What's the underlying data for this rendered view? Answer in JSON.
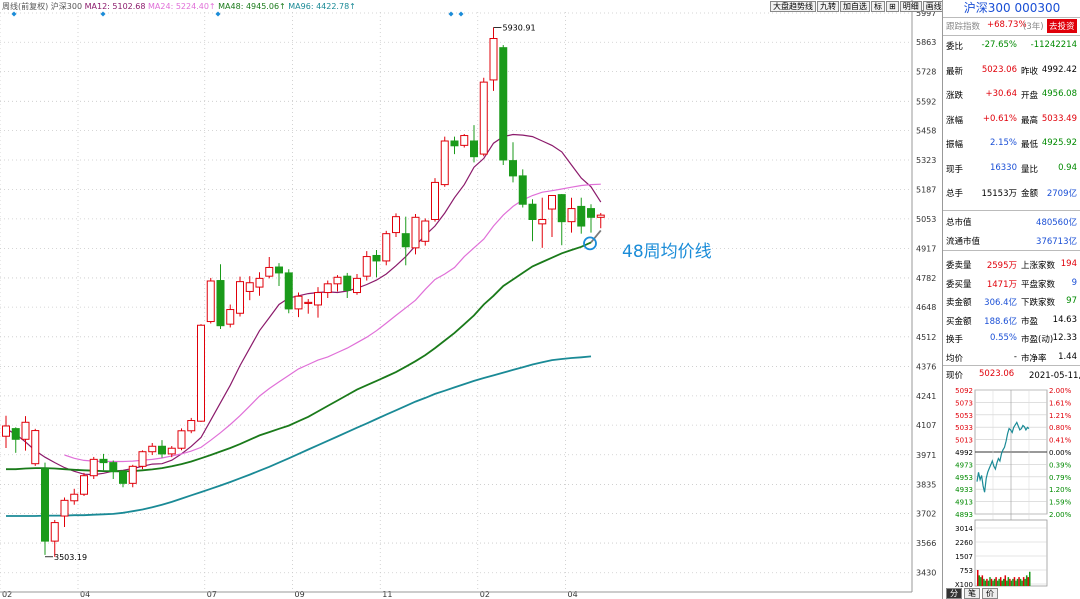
{
  "header": {
    "indicator": "周线(前复权)",
    "name": "沪深300",
    "mas": [
      {
        "label": "MA12: 5102.68",
        "color": "#8b1a6b"
      },
      {
        "label": "MA24: 5224.40↑",
        "color": "#e070d8"
      },
      {
        "label": "MA48: 4945.06↑",
        "color": "#1a7a1a"
      },
      {
        "label": "MA96: 4422.78↑",
        "color": "#1a8a96"
      }
    ]
  },
  "toolbar": [
    "大盘趋势线",
    "九转",
    "加自选",
    "标",
    "⊞",
    "明细",
    "画线",
    "均线",
    "⚙"
  ],
  "annotation": {
    "text": "48周均价线",
    "color": "#1a8cd8"
  },
  "chart_data": [
    {
      "type": "candlestick",
      "ylim": [
        3360,
        5997
      ],
      "y_ticks": [
        5997,
        5863,
        5728,
        5592,
        5458,
        5323,
        5187,
        5053,
        4917,
        4782,
        4648,
        4512,
        4376,
        4241,
        4107,
        3971,
        3835,
        3702,
        3566,
        3430
      ],
      "x_ticks": [
        {
          "label": "02",
          "i": 0
        },
        {
          "label": "04",
          "i": 8
        },
        {
          "label": "07",
          "i": 21
        },
        {
          "label": "09",
          "i": 30
        },
        {
          "label": "11",
          "i": 39
        },
        {
          "label": "02",
          "i": 49
        },
        {
          "label": "04",
          "i": 58
        }
      ],
      "markers": [
        {
          "label": "5930.91",
          "i": 50,
          "value": 5930.91
        },
        {
          "label": "3503.19",
          "i": 4,
          "value": 3503.19
        }
      ],
      "candles": [
        [
          4056,
          4103,
          4150,
          4002
        ],
        [
          4091,
          4042,
          4097,
          3980
        ],
        [
          4042,
          4120,
          4148,
          3990
        ],
        [
          3930,
          4082,
          4090,
          3920
        ],
        [
          3906,
          3575,
          3935,
          3512
        ],
        [
          3575,
          3660,
          3672,
          3503
        ],
        [
          3690,
          3762,
          3775,
          3640
        ],
        [
          3760,
          3790,
          3815,
          3742
        ],
        [
          3790,
          3875,
          3888,
          3782
        ],
        [
          3875,
          3950,
          3961,
          3860
        ],
        [
          3950,
          3935,
          3975,
          3900
        ],
        [
          3935,
          3895,
          3945,
          3860
        ],
        [
          3895,
          3840,
          3900,
          3822
        ],
        [
          3840,
          3918,
          3925,
          3822
        ],
        [
          3918,
          3985,
          3991,
          3905
        ],
        [
          3985,
          4010,
          4025,
          3970
        ],
        [
          4010,
          3975,
          4038,
          3958
        ],
        [
          3975,
          4001,
          4011,
          3960
        ],
        [
          4001,
          4081,
          4092,
          3992
        ],
        [
          4081,
          4128,
          4140,
          4070
        ],
        [
          4125,
          4565,
          4570,
          4122
        ],
        [
          4582,
          4768,
          4782,
          4573
        ],
        [
          4770,
          4563,
          4845,
          4548
        ],
        [
          4570,
          4637,
          4660,
          4555
        ],
        [
          4620,
          4765,
          4788,
          4605
        ],
        [
          4720,
          4760,
          4790,
          4680
        ],
        [
          4740,
          4780,
          4808,
          4700
        ],
        [
          4790,
          4830,
          4878,
          4780
        ],
        [
          4832,
          4805,
          4850,
          4745
        ],
        [
          4805,
          4640,
          4822,
          4620
        ],
        [
          4640,
          4698,
          4715,
          4602
        ],
        [
          4665,
          4670,
          4685,
          4618
        ],
        [
          4658,
          4715,
          4740,
          4600
        ],
        [
          4715,
          4755,
          4770,
          4690
        ],
        [
          4755,
          4785,
          4795,
          4720
        ],
        [
          4790,
          4725,
          4805,
          4690
        ],
        [
          4715,
          4780,
          4800,
          4705
        ],
        [
          4790,
          4880,
          4905,
          4770
        ],
        [
          4885,
          4860,
          4910,
          4785
        ],
        [
          4860,
          4985,
          4998,
          4840
        ],
        [
          4990,
          5063,
          5078,
          4970
        ],
        [
          4985,
          4925,
          5063,
          4840
        ],
        [
          4920,
          5060,
          5075,
          4890
        ],
        [
          4950,
          5043,
          5055,
          4930
        ],
        [
          5050,
          5220,
          5240,
          5040
        ],
        [
          5210,
          5410,
          5430,
          5200
        ],
        [
          5410,
          5388,
          5430,
          5350
        ],
        [
          5390,
          5435,
          5442,
          5380
        ],
        [
          5410,
          5338,
          5483,
          5312
        ],
        [
          5350,
          5680,
          5700,
          5340
        ],
        [
          5690,
          5880,
          5930,
          5640
        ],
        [
          5838,
          5323,
          5850,
          5300
        ],
        [
          5320,
          5250,
          5404,
          5220
        ],
        [
          5250,
          5120,
          5280,
          5105
        ],
        [
          5120,
          5050,
          5143,
          4950
        ],
        [
          5030,
          5050,
          5150,
          4920
        ],
        [
          5098,
          5160,
          5160,
          4970
        ],
        [
          5164,
          5040,
          5167,
          4932
        ],
        [
          5040,
          5100,
          5150,
          4990
        ],
        [
          5110,
          5020,
          5150,
          4985
        ],
        [
          5100,
          5060,
          5120,
          4990
        ],
        [
          5060,
          5070,
          5080,
          5010
        ]
      ],
      "series": [
        {
          "name": "MA12",
          "color": "#8b1a6b",
          "values": [
            4090,
            4065,
            4030,
            3990,
            3960,
            3935,
            3912,
            3895,
            3882,
            3880,
            3886,
            3896,
            3900,
            3908,
            3918,
            3928,
            3930,
            3946,
            3975,
            4010,
            4050,
            4130,
            4210,
            4290,
            4380,
            4460,
            4540,
            4600,
            4660,
            4690,
            4700,
            4710,
            4715,
            4718,
            4715,
            4722,
            4735,
            4752,
            4772,
            4800,
            4838,
            4880,
            4930,
            4978,
            5020,
            5080,
            5150,
            5210,
            5290,
            5330,
            5400,
            5430,
            5440,
            5437,
            5430,
            5410,
            5390,
            5360,
            5300,
            5240,
            5200,
            5130
          ]
        },
        {
          "name": "MA24",
          "color": "#e070d8",
          "values": [
            null,
            null,
            null,
            null,
            null,
            null,
            3970,
            3955,
            3945,
            3942,
            3940,
            3940,
            3940,
            3942,
            3946,
            3950,
            3956,
            3966,
            3975,
            3988,
            4005,
            4038,
            4072,
            4110,
            4150,
            4195,
            4240,
            4275,
            4305,
            4335,
            4365,
            4385,
            4405,
            4420,
            4440,
            4460,
            4485,
            4510,
            4540,
            4575,
            4610,
            4645,
            4680,
            4730,
            4775,
            4800,
            4830,
            4880,
            4920,
            4960,
            5020,
            5070,
            5110,
            5140,
            5160,
            5175,
            5182,
            5190,
            5198,
            5206,
            5210,
            5212
          ]
        },
        {
          "name": "MA48",
          "color": "#1a7a1a",
          "values": [
            3905,
            3905,
            3908,
            3910,
            3910,
            3908,
            3905,
            3902,
            3900,
            3898,
            3896,
            3895,
            3895,
            3896,
            3900,
            3904,
            3910,
            3918,
            3928,
            3940,
            3955,
            3970,
            3986,
            4002,
            4020,
            4040,
            4060,
            4075,
            4090,
            4105,
            4125,
            4145,
            4170,
            4195,
            4220,
            4245,
            4270,
            4290,
            4310,
            4330,
            4350,
            4375,
            4400,
            4428,
            4460,
            4495,
            4530,
            4570,
            4610,
            4660,
            4700,
            4745,
            4775,
            4805,
            4835,
            4855,
            4875,
            4895,
            4910,
            4925,
            4945,
            null
          ]
        },
        {
          "name": "MA96",
          "color": "#1a8a96",
          "values": [
            3690,
            3690,
            3690,
            3690,
            3692,
            3692,
            3692,
            3694,
            3694,
            3696,
            3698,
            3700,
            3705,
            3712,
            3720,
            3730,
            3742,
            3755,
            3770,
            3785,
            3800,
            3815,
            3830,
            3846,
            3863,
            3880,
            3898,
            3916,
            3935,
            3955,
            3975,
            3995,
            4015,
            4035,
            4055,
            4075,
            4095,
            4115,
            4135,
            4155,
            4175,
            4195,
            4215,
            4232,
            4250,
            4265,
            4280,
            4295,
            4310,
            4323,
            4335,
            4348,
            4360,
            4372,
            4385,
            4395,
            4405,
            4410,
            4415,
            4418,
            4422,
            null
          ]
        },
        {
          "name": "MA48-ext",
          "color": "#7a7a7a",
          "values": [
            null,
            null,
            null,
            null,
            null,
            null,
            null,
            null,
            null,
            null,
            null,
            null,
            null,
            null,
            null,
            null,
            null,
            null,
            null,
            null,
            null,
            null,
            null,
            null,
            null,
            null,
            null,
            null,
            null,
            null,
            null,
            null,
            null,
            null,
            null,
            null,
            null,
            null,
            null,
            null,
            null,
            null,
            null,
            null,
            null,
            null,
            null,
            null,
            null,
            null,
            null,
            null,
            null,
            null,
            null,
            null,
            null,
            null,
            null,
            null,
            4945,
            5000
          ]
        }
      ]
    },
    {
      "type": "line",
      "name": "intraday",
      "y_ticks_left": [
        "5092",
        "5073",
        "5053",
        "5033",
        "5013",
        "4992",
        "4973",
        "4953",
        "4933",
        "4913",
        "4893"
      ],
      "y_ticks_right": [
        "2.00%",
        "1.61%",
        "1.21%",
        "0.80%",
        "0.41%",
        "0.00%",
        "0.39%",
        "0.79%",
        "1.20%",
        "1.59%",
        "2.00%"
      ],
      "ylim": [
        4893,
        5092
      ],
      "prev_close": 4992.42,
      "values": [
        4945,
        4960,
        4948,
        4955,
        4938,
        4928,
        4950,
        4960,
        4966,
        4972,
        4978,
        4970,
        4965,
        4975,
        4982,
        4978,
        4990,
        4996,
        5000,
        5010,
        5022,
        5030,
        5028,
        5024,
        5032,
        5036,
        5040,
        5034,
        5028,
        5030,
        5035,
        5033,
        5028,
        5032,
        5030
      ]
    },
    {
      "type": "bar",
      "name": "volume",
      "y_ticks": [
        "3014",
        "2260",
        "1507",
        "753",
        "X100"
      ],
      "values": [
        9,
        6,
        5,
        6,
        4,
        3,
        4,
        3,
        5,
        4,
        3,
        4,
        5,
        3,
        4,
        5,
        3,
        4,
        6,
        3,
        5,
        4,
        3,
        4,
        5,
        3,
        4,
        5,
        4,
        3,
        5,
        4,
        6,
        5,
        8
      ]
    }
  ],
  "side": {
    "title": "沪深300 000300",
    "track": {
      "label": "跟踪指数",
      "value": "+68.73%",
      "period": "(3年)",
      "btn": "去投资"
    },
    "rows": [
      {
        "l1": "委比",
        "v1": "-27.65%",
        "c1": "green",
        "v2": "-11242214",
        "c2": "green"
      },
      {
        "l1": "最新",
        "v1": "5023.06",
        "c1": "red",
        "l2": "昨收",
        "v2": "4992.42",
        "c2": ""
      },
      {
        "l1": "涨跌",
        "v1": "+30.64",
        "c1": "red",
        "l2": "开盘",
        "v2": "4956.08",
        "c2": "green"
      },
      {
        "l1": "涨幅",
        "v1": "+0.61%",
        "c1": "red",
        "l2": "最高",
        "v2": "5033.49",
        "c2": "red"
      },
      {
        "l1": "振幅",
        "v1": "2.15%",
        "c1": "blue",
        "l2": "最低",
        "v2": "4925.92",
        "c2": "green"
      },
      {
        "l1": "现手",
        "v1": "16330",
        "c1": "blue",
        "l2": "量比",
        "v2": "0.94",
        "c2": "green"
      },
      {
        "l1": "总手",
        "v1": "15153万",
        "c1": "",
        "l2": "金额",
        "v2": "2709亿",
        "c2": "blue"
      }
    ],
    "mcap": [
      {
        "label": "总市值",
        "value": "480560亿"
      },
      {
        "label": "流通市值",
        "value": "376713亿"
      }
    ],
    "stats": [
      {
        "l1": "委卖量",
        "v1": "2595万",
        "c1": "red",
        "l2": "上涨家数",
        "v2": "194",
        "c2": "red"
      },
      {
        "l1": "委买量",
        "v1": "1471万",
        "c1": "red",
        "l2": "平盘家数",
        "v2": "9",
        "c2": "blue"
      },
      {
        "l1": "卖金额",
        "v1": "306.4亿",
        "c1": "blue",
        "l2": "下跌家数",
        "v2": "97",
        "c2": "green"
      },
      {
        "l1": "买金额",
        "v1": "188.6亿",
        "c1": "blue",
        "l2": "市盈",
        "v2": "14.63",
        "c2": ""
      },
      {
        "l1": "换手",
        "v1": "0.55%",
        "c1": "blue",
        "l2": "市盈(动)",
        "v2": "12.33",
        "c2": ""
      },
      {
        "l1": "均价",
        "v1": "-",
        "c1": "",
        "l2": "市净率",
        "v2": "1.44",
        "c2": ""
      }
    ],
    "price_row": {
      "label": "现价",
      "value": "5023.06",
      "date": "2021-05-11,二"
    },
    "tabs": [
      "分",
      "笔",
      "价"
    ]
  }
}
